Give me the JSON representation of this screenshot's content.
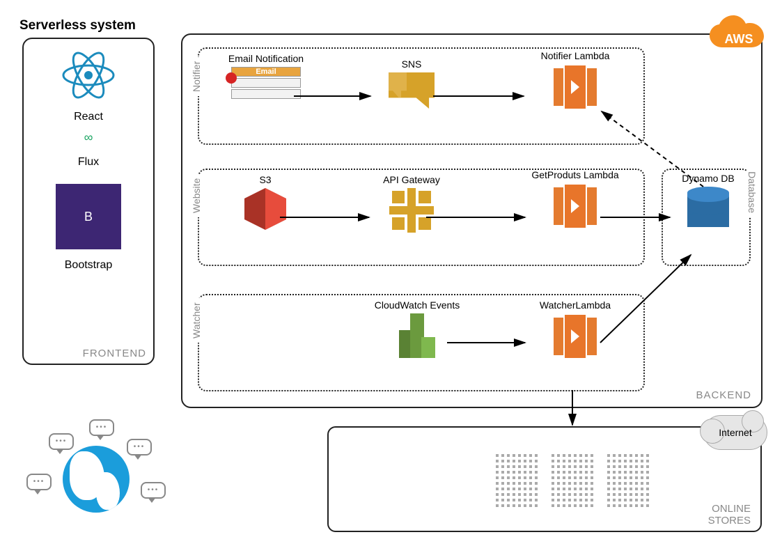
{
  "title": "Serverless system",
  "frontend": {
    "label": "FRONTEND",
    "react": "React",
    "flux": "Flux",
    "bootstrap": "Bootstrap",
    "bootstrap_glyph": "B",
    "infinity": "∞"
  },
  "backend": {
    "label": "BACKEND",
    "cloud_badge": "AWS",
    "lanes": {
      "notifier": "Notifier",
      "website": "Website",
      "watcher": "Watcher",
      "database": "Database"
    },
    "nodes": {
      "email": "Email Notification",
      "email_bar": "Email",
      "sns": "SNS",
      "notifier_lambda": "Notifier Lambda",
      "s3": "S3",
      "api_gateway": "API Gateway",
      "getproducts_lambda": "GetProduts Lambda",
      "dynamo": "Dynamo DB",
      "cloudwatch": "CloudWatch Events",
      "watcher_lambda": "WatcherLambda"
    }
  },
  "online": {
    "label_line1": "ONLINE",
    "label_line2": "STORES",
    "internet": "Internet"
  },
  "colors": {
    "lambda": "#e8752a",
    "sns": "#d6a229",
    "s3": "#c0392b",
    "cloudwatch": "#6b9a3e",
    "dynamo": "#2b6ca3",
    "aws": "#f58f20",
    "bootstrap": "#3d2673",
    "globe": "#1b9ddb"
  }
}
